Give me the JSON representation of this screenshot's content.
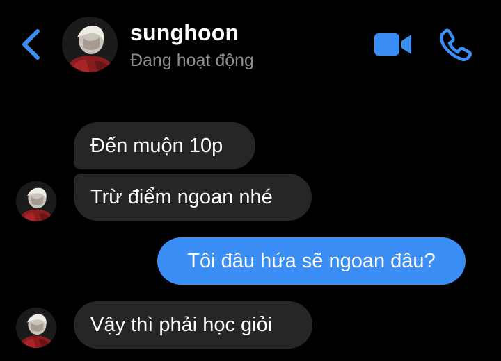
{
  "header": {
    "name": "sunghoon",
    "status": "Đang hoạt động"
  },
  "icons": {
    "back": "chevron-left-icon",
    "video": "video-camera-icon",
    "phone": "phone-icon",
    "accent_color": "#3a8ef6"
  },
  "messages": [
    {
      "direction": "incoming",
      "text": "Đến muộn 10p"
    },
    {
      "direction": "incoming",
      "text": "Trừ điểm ngoan nhé"
    },
    {
      "direction": "outgoing",
      "text": "Tôi đâu hứa sẽ ngoan đâu?"
    },
    {
      "direction": "incoming",
      "text": "Vậy thì phải học giỏi"
    }
  ],
  "colors": {
    "background": "#000000",
    "incoming_bubble": "#262628",
    "outgoing_bubble": "#3a8ef6",
    "status_text": "#8e8e93"
  }
}
